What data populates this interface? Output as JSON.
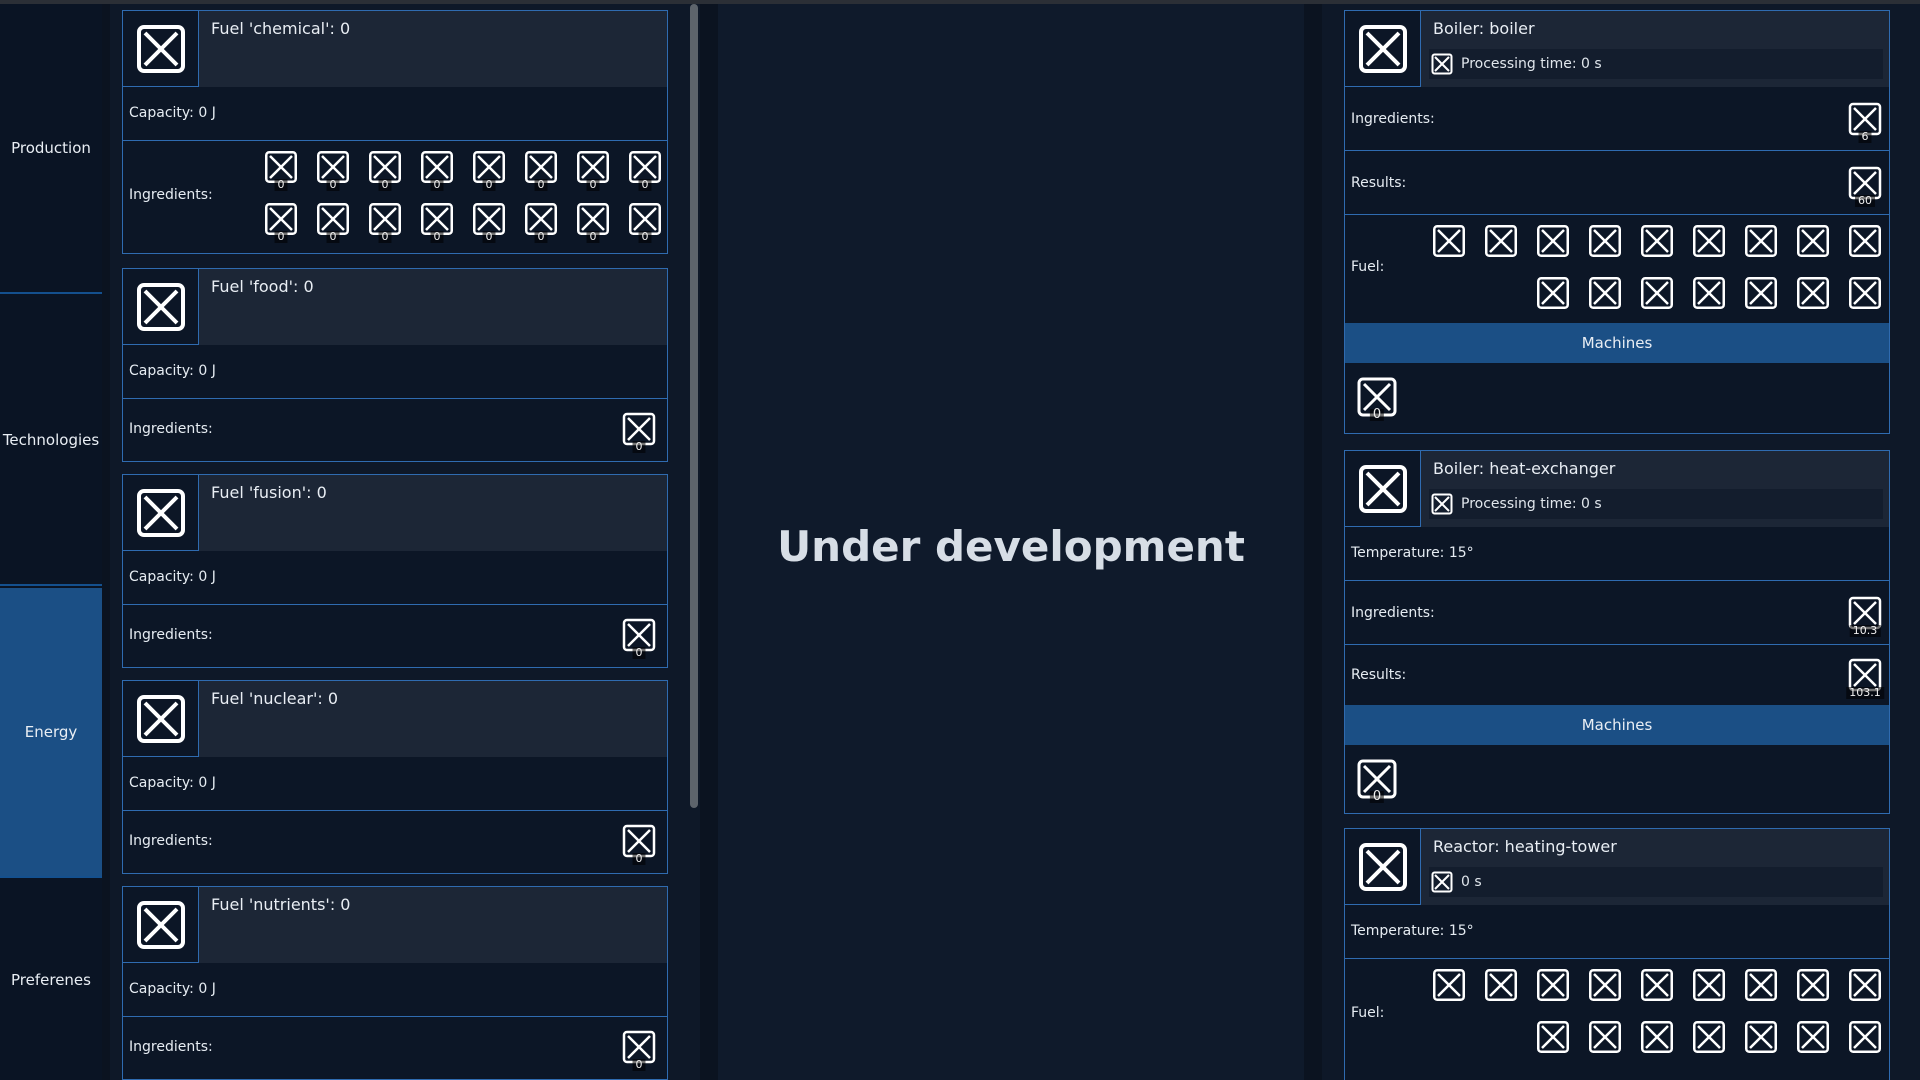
{
  "sidebar": {
    "items": [
      {
        "label": "Production",
        "active": false
      },
      {
        "label": "Technologies",
        "active": false
      },
      {
        "label": "Energy",
        "active": true
      },
      {
        "label": "Preferenes",
        "active": false
      }
    ]
  },
  "fuels": [
    {
      "title": "Fuel 'chemical': 0",
      "capacity": "Capacity: 0 J",
      "ingredients_label": "Ingredients:",
      "ingredient_counts": [
        "0",
        "0",
        "0",
        "0",
        "0",
        "0",
        "0",
        "0",
        "0",
        "0",
        "0",
        "0",
        "0",
        "0",
        "0",
        "0"
      ]
    },
    {
      "title": "Fuel 'food': 0",
      "capacity": "Capacity: 0 J",
      "ingredients_label": "Ingredients:",
      "ingredient_counts": [
        "0"
      ]
    },
    {
      "title": "Fuel 'fusion': 0",
      "capacity": "Capacity: 0 J",
      "ingredients_label": "Ingredients:",
      "ingredient_counts": [
        "0"
      ]
    },
    {
      "title": "Fuel 'nuclear': 0",
      "capacity": "Capacity: 0 J",
      "ingredients_label": "Ingredients:",
      "ingredient_counts": [
        "0"
      ]
    },
    {
      "title": "Fuel 'nutrients': 0",
      "capacity": "Capacity: 0 J",
      "ingredients_label": "Ingredients:",
      "ingredient_counts": [
        "0"
      ]
    }
  ],
  "middle": {
    "message": "Under development"
  },
  "machines": {
    "boiler": {
      "title": "Boiler: boiler",
      "processing": "Processing time: 0 s",
      "ingredients_label": "Ingredients:",
      "ingredient_count": "6",
      "results_label": "Results:",
      "result_count": "60",
      "fuel_label": "Fuel:",
      "machines_label": "Machines",
      "machine_count": "0"
    },
    "heat_exchanger": {
      "title": "Boiler: heat-exchanger",
      "processing": "Processing time: 0 s",
      "temperature": "Temperature: 15°",
      "ingredients_label": "Ingredients:",
      "ingredient_count": "10.3",
      "results_label": "Results:",
      "result_count": "103.1",
      "machines_label": "Machines",
      "machine_count": "0"
    },
    "heating_tower": {
      "title": "Reactor: heating-tower",
      "processing": "0 s",
      "temperature": "Temperature: 15°",
      "fuel_label": "Fuel:"
    }
  },
  "icons": {
    "missing": "missing-image-icon"
  },
  "colors": {
    "accent": "#2f6bb0",
    "active": "#1b4f85",
    "background": "#0b1320"
  }
}
